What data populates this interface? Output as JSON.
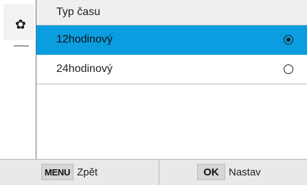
{
  "sidebar": {
    "icon": "gear-icon",
    "icon_glyph": "✿"
  },
  "panel": {
    "title": "Typ času",
    "options": [
      {
        "label": "12hodinový",
        "selected": true
      },
      {
        "label": "24hodinový",
        "selected": false
      }
    ]
  },
  "bottom_bar": {
    "back_key": "MENU",
    "back_label": "Zpět",
    "confirm_key": "OK",
    "confirm_label": "Nastav"
  },
  "colors": {
    "selection": "#0a9ee0",
    "title_bar": "#efefef",
    "bottom_bar": "#e9e9e9"
  }
}
